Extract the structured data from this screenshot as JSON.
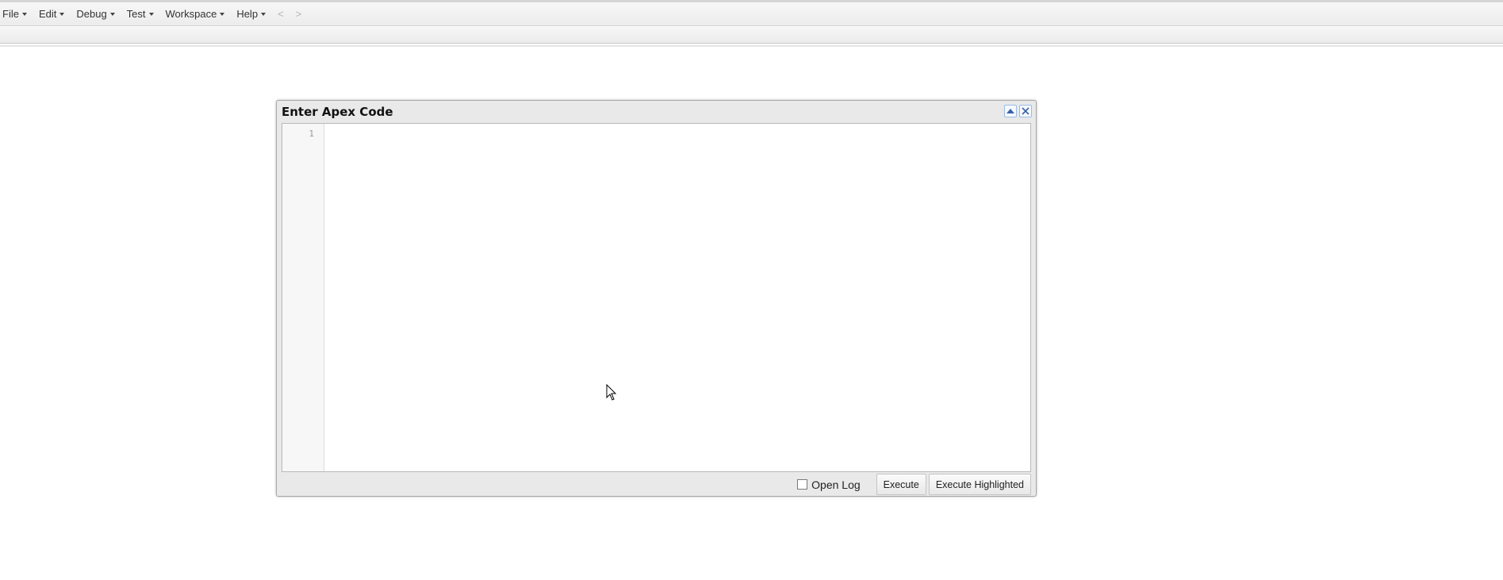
{
  "menubar": {
    "items": [
      {
        "label": "File"
      },
      {
        "label": "Edit"
      },
      {
        "label": "Debug"
      },
      {
        "label": "Test"
      },
      {
        "label": "Workspace"
      },
      {
        "label": "Help"
      }
    ],
    "back_label": "<",
    "forward_label": ">"
  },
  "dialog": {
    "title": "Enter Apex Code",
    "editor": {
      "line_numbers": [
        "1"
      ],
      "content": ""
    },
    "footer": {
      "open_log_label": "Open Log",
      "open_log_checked": false,
      "execute_label": "Execute",
      "execute_highlighted_label": "Execute Highlighted"
    }
  },
  "icons": {
    "collapse": "collapse-up-icon",
    "close": "close-icon",
    "cursor": "mouse-pointer-icon"
  },
  "colors": {
    "tool_border": "#99bbe8",
    "tool_glyph": "#3a63a6"
  }
}
